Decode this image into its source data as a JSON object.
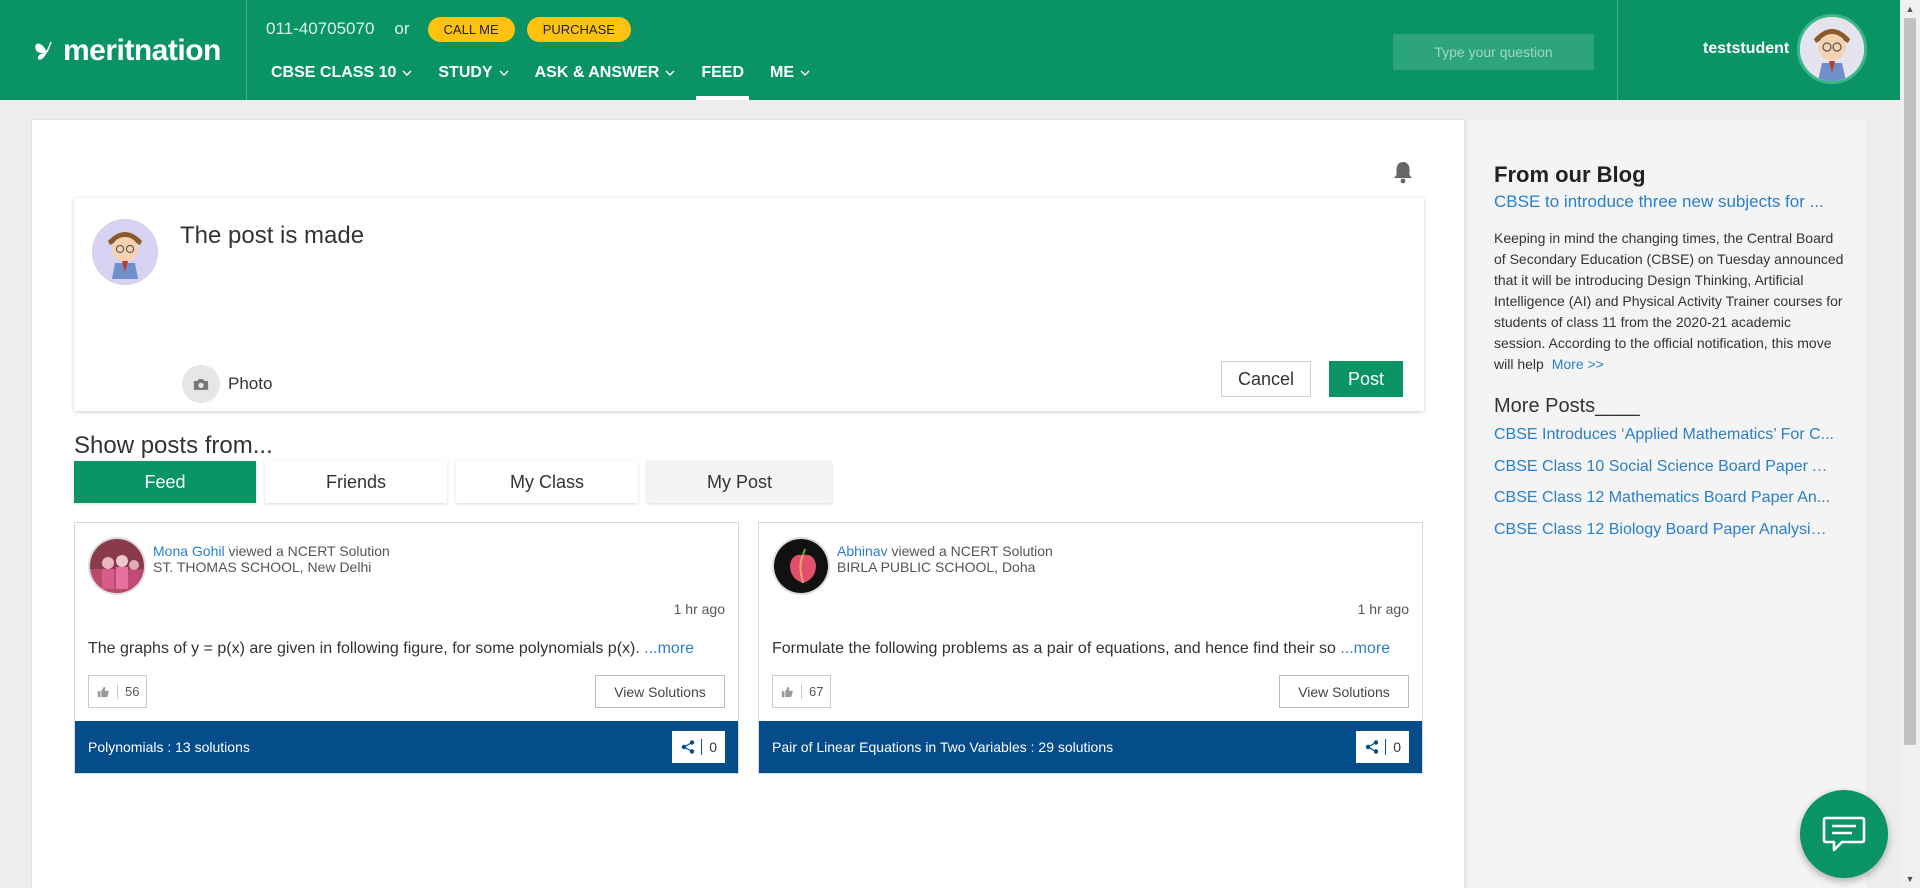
{
  "header": {
    "logo_text": "meritnation",
    "phone": "011-40705070",
    "or_text": "or",
    "call_me": "CALL ME",
    "purchase": "PURCHASE",
    "nav": [
      {
        "label": "CBSE CLASS 10"
      },
      {
        "label": "STUDY"
      },
      {
        "label": "ASK & ANSWER"
      },
      {
        "label": "FEED"
      },
      {
        "label": "ME"
      }
    ],
    "search_placeholder": "Type your question",
    "username": "teststudent"
  },
  "composer": {
    "text": "The post is made",
    "photo_label": "Photo",
    "cancel_label": "Cancel",
    "post_label": "Post"
  },
  "filters": {
    "title": "Show posts from...",
    "tabs": [
      "Feed",
      "Friends",
      "My Class",
      "My Post"
    ],
    "active": "Feed"
  },
  "feed": [
    {
      "user": "Mona Gohil",
      "action": "viewed a NCERT Solution",
      "school": "ST. THOMAS SCHOOL, New Delhi",
      "time": "1 hr ago",
      "question": "The graphs of y = p(x) are given in following figure, for some polynomials p(x).",
      "more": "...more",
      "likes": "56",
      "view_label": "View Solutions",
      "footer": "Polynomials : 13 solutions",
      "shares": "0"
    },
    {
      "user": "Abhinav",
      "action": "viewed a NCERT Solution",
      "school": "BIRLA PUBLIC SCHOOL, Doha",
      "time": "1 hr ago",
      "question": "Formulate the following problems as a pair of equations, and hence find their so",
      "more": "...more",
      "likes": "67",
      "view_label": "View Solutions",
      "footer": "Pair of Linear Equations in Two Variables : 29 solutions",
      "shares": "0"
    }
  ],
  "sidebar": {
    "blog_title": "From our Blog",
    "blog_link": "CBSE to introduce three new subjects for ...",
    "blog_body": "Keeping in mind the changing times, the Central Board of Secondary Education (CBSE) on Tuesday announced that it will be introducing Design Thinking, Artificial Intelligence (AI) and Physical Activity Trainer courses for students of class 11 from the 2020-21 academic session. According to the official notification, this move will help",
    "blog_more": "More >>",
    "more_posts_title": "More Posts____",
    "more_posts": [
      "CBSE Introduces ‘Applied Mathematics’ For C...",
      "CBSE Class 10 Social Science Board Paper A...",
      "CBSE Class 12 Mathematics Board Paper An...",
      "CBSE Class 12 Biology Board Paper Analysis ..."
    ]
  },
  "colors": {
    "brand_green": "#0a9466",
    "accent_yellow": "#ffc20e",
    "footer_blue": "#044c8a",
    "link_blue": "#2a7fc9"
  }
}
